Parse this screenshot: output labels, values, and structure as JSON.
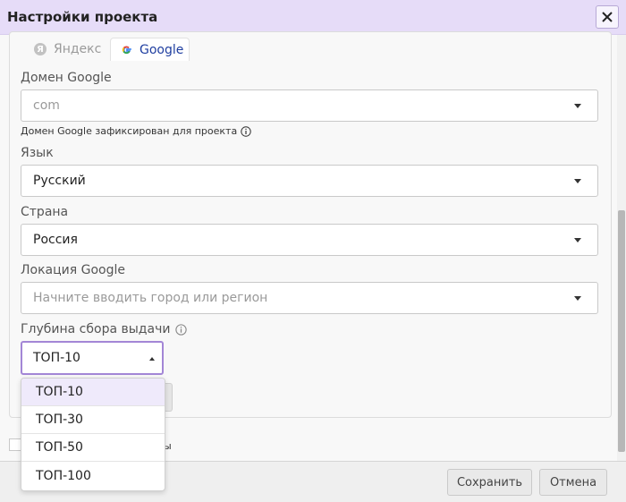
{
  "dialog": {
    "title": "Настройки проекта"
  },
  "tabs": [
    {
      "label": "Яндекс",
      "icon_letter": "Я",
      "active": false
    },
    {
      "label": "Google",
      "active": true
    }
  ],
  "google_domain": {
    "label": "Домен Google",
    "value": "com",
    "hint": "Домен Google зафиксирован для проекта"
  },
  "language": {
    "label": "Язык",
    "value": "Русский"
  },
  "country": {
    "label": "Страна",
    "value": "Россия"
  },
  "location": {
    "label": "Локация Google",
    "placeholder": "Начните вводить город или регион"
  },
  "depth": {
    "label": "Глубина сбора выдачи",
    "value": "ТОП-10",
    "options": [
      "ТОП-10",
      "ТОП-30",
      "ТОП-50",
      "ТОП-100"
    ]
  },
  "checkbox_tail": "ы",
  "footer": {
    "save_label": "Сохранить",
    "cancel_label": "Отмена"
  },
  "colors": {
    "title_bar": "#e6dcf8",
    "accent": "#a386d6",
    "tab_active_text": "#1f3ea0"
  },
  "icons": {
    "close": "close-icon",
    "info": "info-icon",
    "google": "google-g-icon",
    "yandex": "yandex-icon",
    "dropdown": "chevron-down-icon"
  }
}
